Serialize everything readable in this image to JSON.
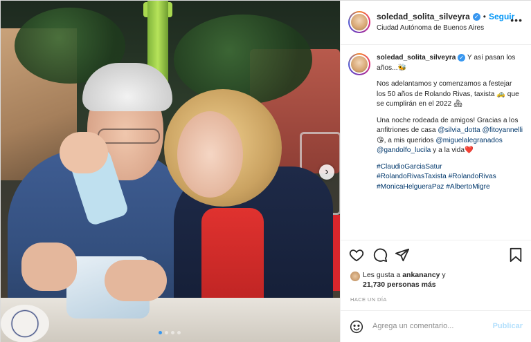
{
  "post": {
    "username": "soledad_solita_silveyra",
    "follow_label": "Seguir",
    "separator": "•",
    "location": "Ciudad Autónoma de Buenos Aires",
    "more_label": "•••"
  },
  "caption": {
    "username": "soledad_solita_silveyra",
    "line1": "Y así pasan los años...🐝",
    "line2": "Nos adelantamos y comenzamos a festejar los 50 años de Rolando Rivas, taxista 🚕 que se cumplirán en el 2022 🏘",
    "line3_a": "Una noche rodeada de amigos! Gracias a los anfitriones de casa ",
    "mention1": "@silvia_dotta",
    "mention2": "@fitoyannelli",
    "line3_b": " 😘, a mis queridos ",
    "mention3": "@miguelalegranados",
    "mention4": "@gandolfo_lucila",
    "line3_c": " y a la vida❤️",
    "hashtag1": "#ClaudioGarciaSatur",
    "hashtag2": "#RolandoRivasTaxista",
    "hashtag3": "#RolandoRivas",
    "hashtag4": "#MonicaHelgueraPaz",
    "hashtag5": "#AlbertoMigre"
  },
  "likes": {
    "prefix": "Les gusta a ",
    "user": "ankanancy",
    "connector": " y",
    "count": "21,730 personas más"
  },
  "timestamp": "HACE UN DÍA",
  "comment": {
    "placeholder": "Agrega un comentario...",
    "post_label": "Publicar"
  },
  "carousel": {
    "next_glyph": "›",
    "active_index": 0,
    "total": 4
  },
  "icons": {
    "like": "heart-icon",
    "comment": "comment-icon",
    "share": "share-icon",
    "save": "bookmark-icon",
    "emoji": "emoji-icon",
    "verified": "verified-badge-icon"
  },
  "colors": {
    "link": "#00376b",
    "accent": "#0095f6",
    "muted": "#8e8e8e",
    "post_disabled": "#b2dffc"
  }
}
